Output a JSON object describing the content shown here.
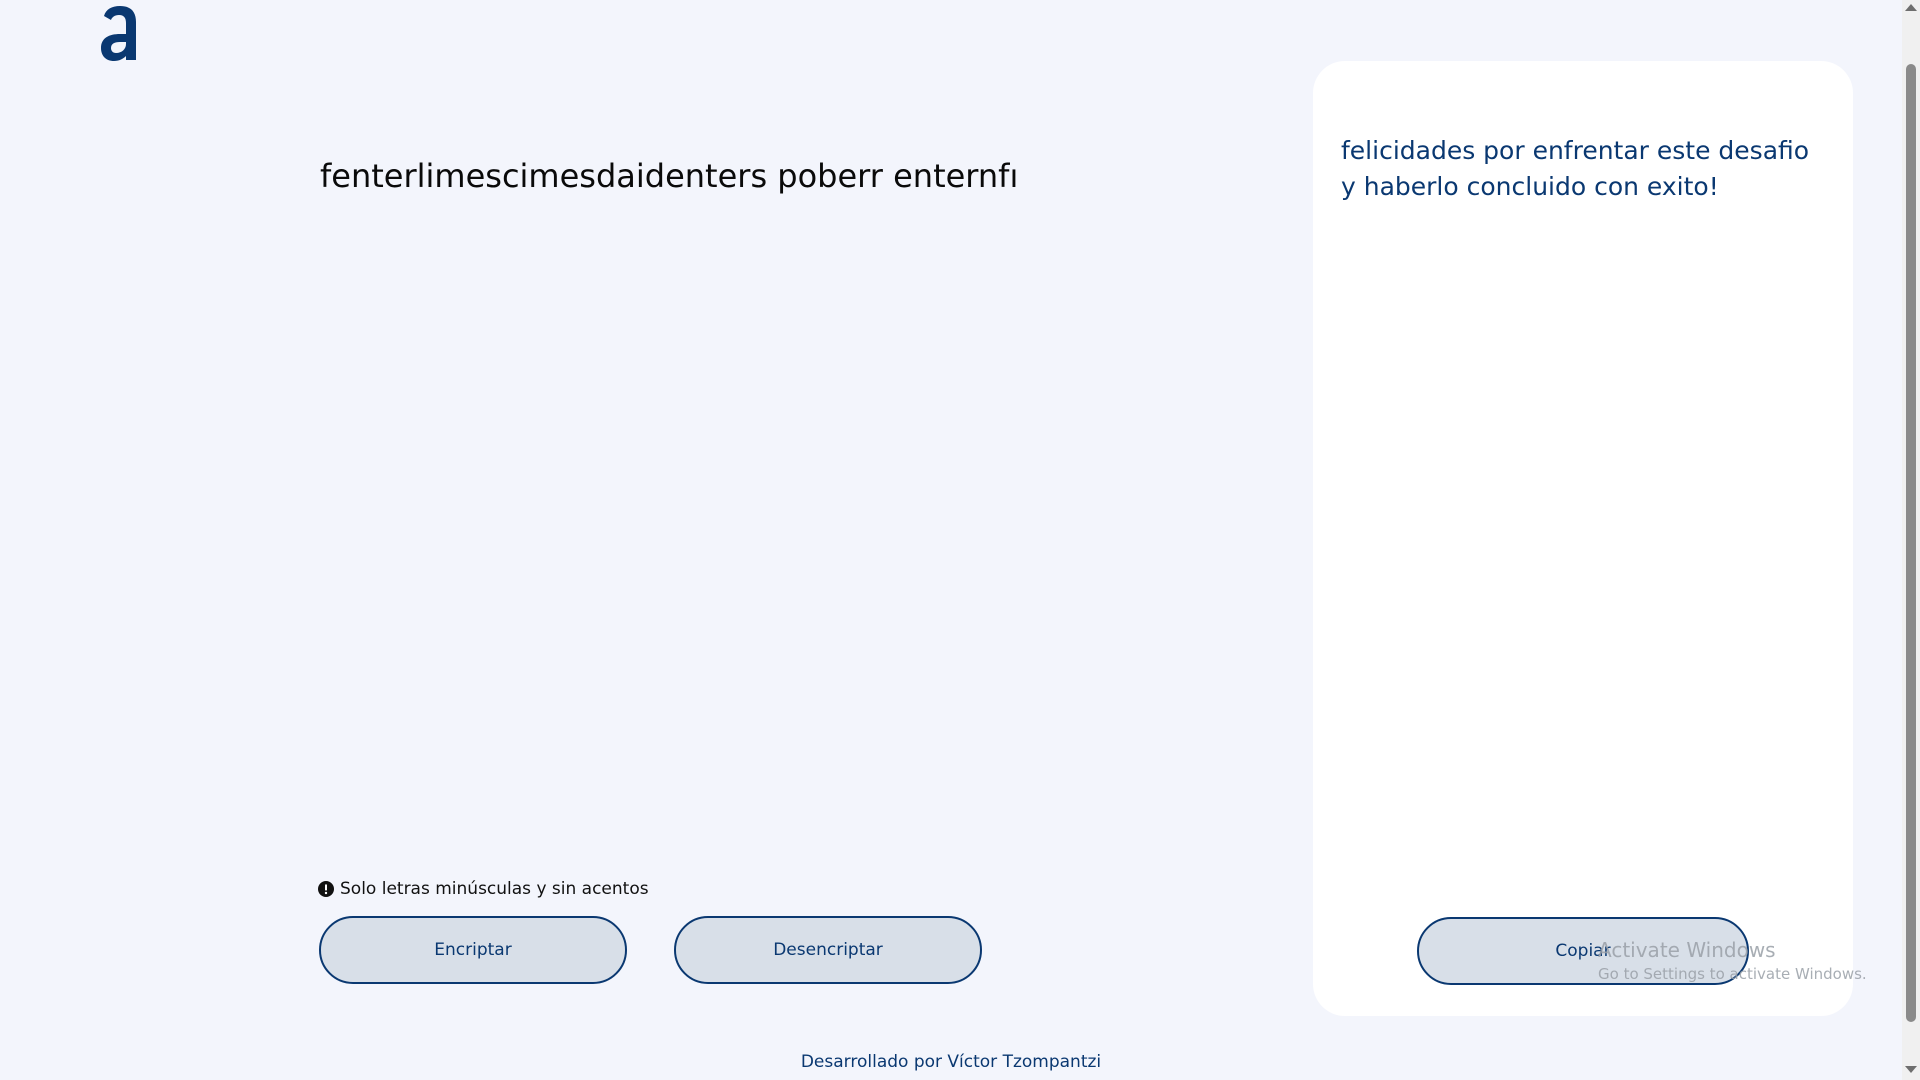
{
  "input": {
    "value": "fenterlimescimesdaidenters poberr enternfı"
  },
  "hint": {
    "text": "Solo letras minúsculas y sin acentos",
    "icon": "exclamation-circle-icon"
  },
  "buttons": {
    "encrypt_label": "Encriptar",
    "decrypt_label": "Desencriptar",
    "copy_label": "Copiar"
  },
  "output": {
    "text": "felicidades por enfrentar este desafio y haberlo concluido con exito!"
  },
  "watermark": {
    "title": "Activate Windows",
    "subtitle": "Go to Settings to activate Windows."
  },
  "footer": {
    "text": "Desarrollado por Víctor Tzompantzi"
  },
  "colors": {
    "background": "#f3f5fc",
    "primary": "#0a3871",
    "button_fill": "#d8dfe8",
    "panel": "#ffffff"
  }
}
